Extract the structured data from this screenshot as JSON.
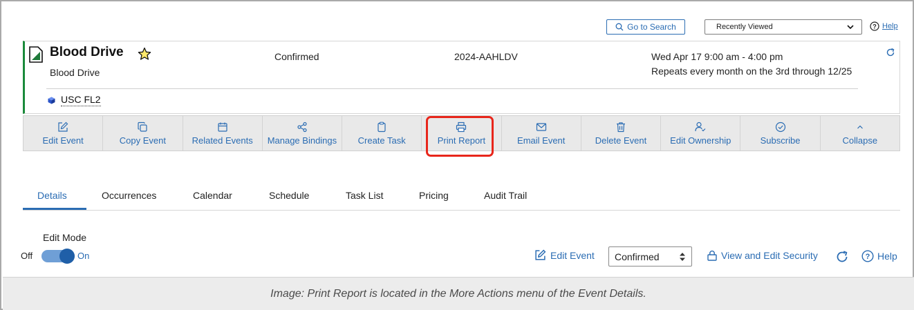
{
  "topbar": {
    "go_to_search": "Go to Search",
    "recently_viewed": "Recently Viewed",
    "help": "Help"
  },
  "event": {
    "title": "Blood Drive",
    "subtitle": "Blood Drive",
    "status": "Confirmed",
    "reference": "2024-AAHLDV",
    "date": "Wed Apr 17 9:00 am - 4:00 pm",
    "repeat": "Repeats every month on the 3rd through 12/25",
    "location": "USC FL2"
  },
  "toolbar": {
    "edit_event": "Edit Event",
    "copy_event": "Copy Event",
    "related_events": "Related Events",
    "manage_bindings": "Manage Bindings",
    "create_task": "Create Task",
    "print_report": "Print Report",
    "email_event": "Email Event",
    "delete_event": "Delete Event",
    "edit_ownership": "Edit Ownership",
    "subscribe": "Subscribe",
    "collapse": "Collapse"
  },
  "tabs": {
    "details": "Details",
    "occurrences": "Occurrences",
    "calendar": "Calendar",
    "schedule": "Schedule",
    "task_list": "Task List",
    "pricing": "Pricing",
    "audit_trail": "Audit Trail"
  },
  "details": {
    "edit_mode_label": "Edit Mode",
    "off": "Off",
    "on": "On",
    "edit_event": "Edit Event",
    "status_value": "Confirmed",
    "view_edit_security": "View and Edit Security",
    "help": "Help"
  },
  "caption": "Image: Print Report is located in the More Actions menu of the Event Details.",
  "colors": {
    "link_blue": "#2a6cb3",
    "highlight_red": "#e8261b",
    "card_accent_green": "#1a8a3a",
    "toggle_knob": "#1f5fa8"
  },
  "icons": {
    "toggle_on": true,
    "favorite": "star-icon",
    "location": "cube-icon"
  }
}
